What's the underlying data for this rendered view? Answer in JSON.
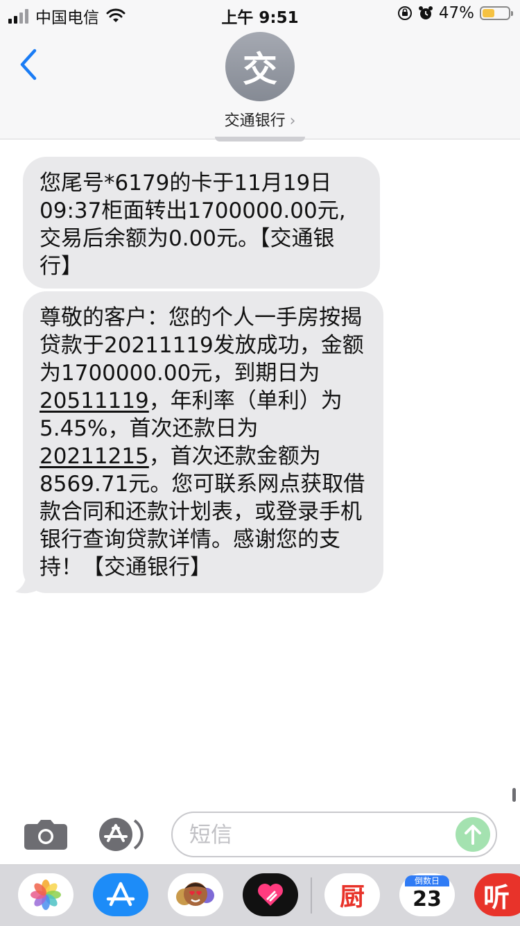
{
  "status_bar": {
    "carrier": "中国电信",
    "time": "上午 9:51",
    "battery_percent": "47%",
    "battery_level": 0.47
  },
  "header": {
    "back_icon": "chevron-left-icon",
    "avatar_char": "交",
    "contact_name": "交通银行",
    "contact_chevron": "›"
  },
  "messages": [
    {
      "segments": [
        {
          "text": "您尾号*6179的卡于11月19日09:37柜面转出1700000.00元,交易后余额为0.00元。【交通银行】",
          "u": false
        }
      ]
    },
    {
      "segments": [
        {
          "text": "尊敬的客户：您的个人一手房按揭贷款于20211119发放成功，金额为1700000.00元，到期日为",
          "u": false
        },
        {
          "text": "20511119",
          "u": true
        },
        {
          "text": "，年利率（单利）为5.45%，首次还款日为",
          "u": false
        },
        {
          "text": "20211215",
          "u": true
        },
        {
          "text": "，首次还款金额为8569.71元。您可联系网点获取借款合同和还款计划表，或登录手机银行查询贷款详情。感谢您的支持！【交通银行】",
          "u": false
        }
      ]
    }
  ],
  "composer": {
    "placeholder": "短信",
    "camera_icon": "camera-icon",
    "appstore_icon": "app-store-icon",
    "send_icon": "send-arrow-icon"
  },
  "app_drawer": {
    "apps": [
      "photos-icon",
      "app-store-icon",
      "memoji-icon",
      "digital-touch-icon",
      "kitchen-app-icon",
      "countdown-app-icon",
      "listen-app-icon"
    ],
    "kitchen_char": "厨",
    "countdown_label": "倒数日",
    "countdown_value": "23",
    "listen_char": "听"
  },
  "colors": {
    "accent": "#1a7cf5",
    "bubble": "#e9e9eb",
    "send_disabled": "#a4e2b0",
    "battery_fill": "#f5c242"
  }
}
